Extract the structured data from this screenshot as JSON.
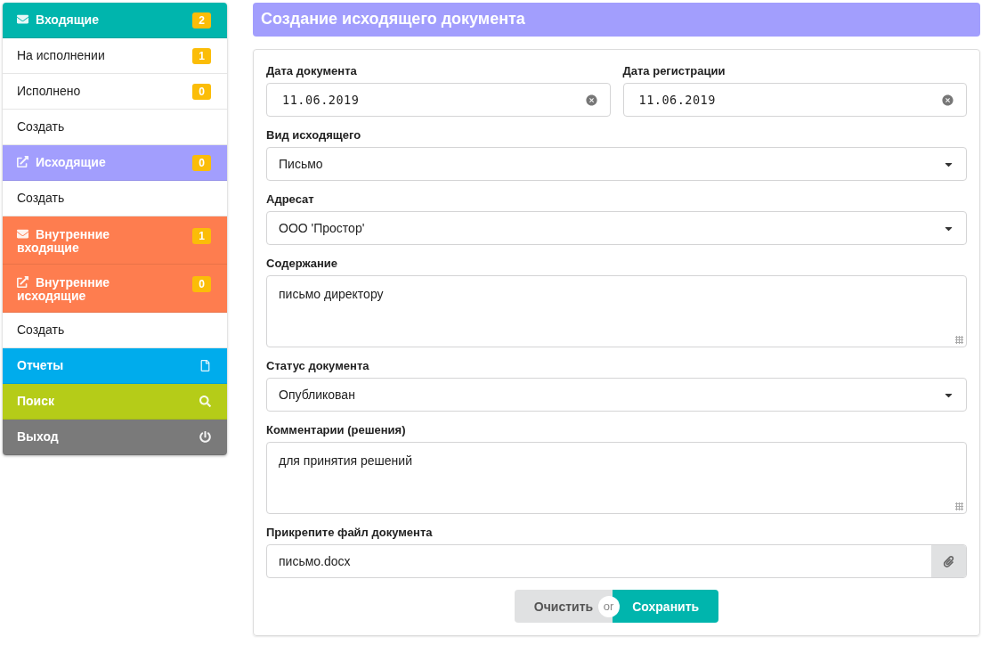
{
  "sidebar": {
    "items": [
      {
        "kind": "incoming",
        "label": "Входящие",
        "badge": "2",
        "color": "#00b5ad"
      },
      {
        "kind": "sub",
        "label": "На исполнении",
        "badge": "1"
      },
      {
        "kind": "sub",
        "label": "Исполнено",
        "badge": "0"
      },
      {
        "kind": "sub",
        "label": "Создать"
      },
      {
        "kind": "outgoing",
        "label": "Исходящие",
        "badge": "0",
        "color": "#a29efd"
      },
      {
        "kind": "sub",
        "label": "Создать"
      },
      {
        "kind": "incoming",
        "label": "Внутренние входящие",
        "badge": "1",
        "color": "#fe7d4f"
      },
      {
        "kind": "outgoing",
        "label": "Внутренние исходящие",
        "badge": "0",
        "color": "#fe7d4f"
      },
      {
        "kind": "sub",
        "label": "Создать"
      },
      {
        "kind": "reports",
        "label": "Отчеты",
        "color": "#00acec"
      },
      {
        "kind": "search",
        "label": "Поиск",
        "color": "#b5cc18"
      },
      {
        "kind": "exit",
        "label": "Выход",
        "color": "#7a7a7a"
      }
    ]
  },
  "page_title": "Создание исходящего документа",
  "form": {
    "rows": [
      [
        {
          "kind": "date",
          "label": "Дата документа",
          "value": "11.06.2019"
        },
        {
          "kind": "date",
          "label": "Дата регистрации",
          "value": "11.06.2019"
        }
      ],
      [
        {
          "kind": "select",
          "label": "Вид исходящего",
          "value": "Письмо"
        }
      ],
      [
        {
          "kind": "select",
          "label": "Адресат",
          "value": "ООО 'Простор'"
        }
      ],
      [
        {
          "kind": "textarea",
          "label": "Содержание",
          "value": "письмо директору"
        }
      ],
      [
        {
          "kind": "select",
          "label": "Статус документа",
          "value": "Опубликован"
        }
      ],
      [
        {
          "kind": "textarea",
          "label": "Комментарии (решения)",
          "value": "для принятия решений"
        }
      ],
      [
        {
          "kind": "file",
          "label": "Прикрепите файл документа",
          "value": "письмо.docx"
        }
      ]
    ],
    "buttons": {
      "clear": "Очистить",
      "or": "or",
      "save": "Сохранить"
    }
  }
}
